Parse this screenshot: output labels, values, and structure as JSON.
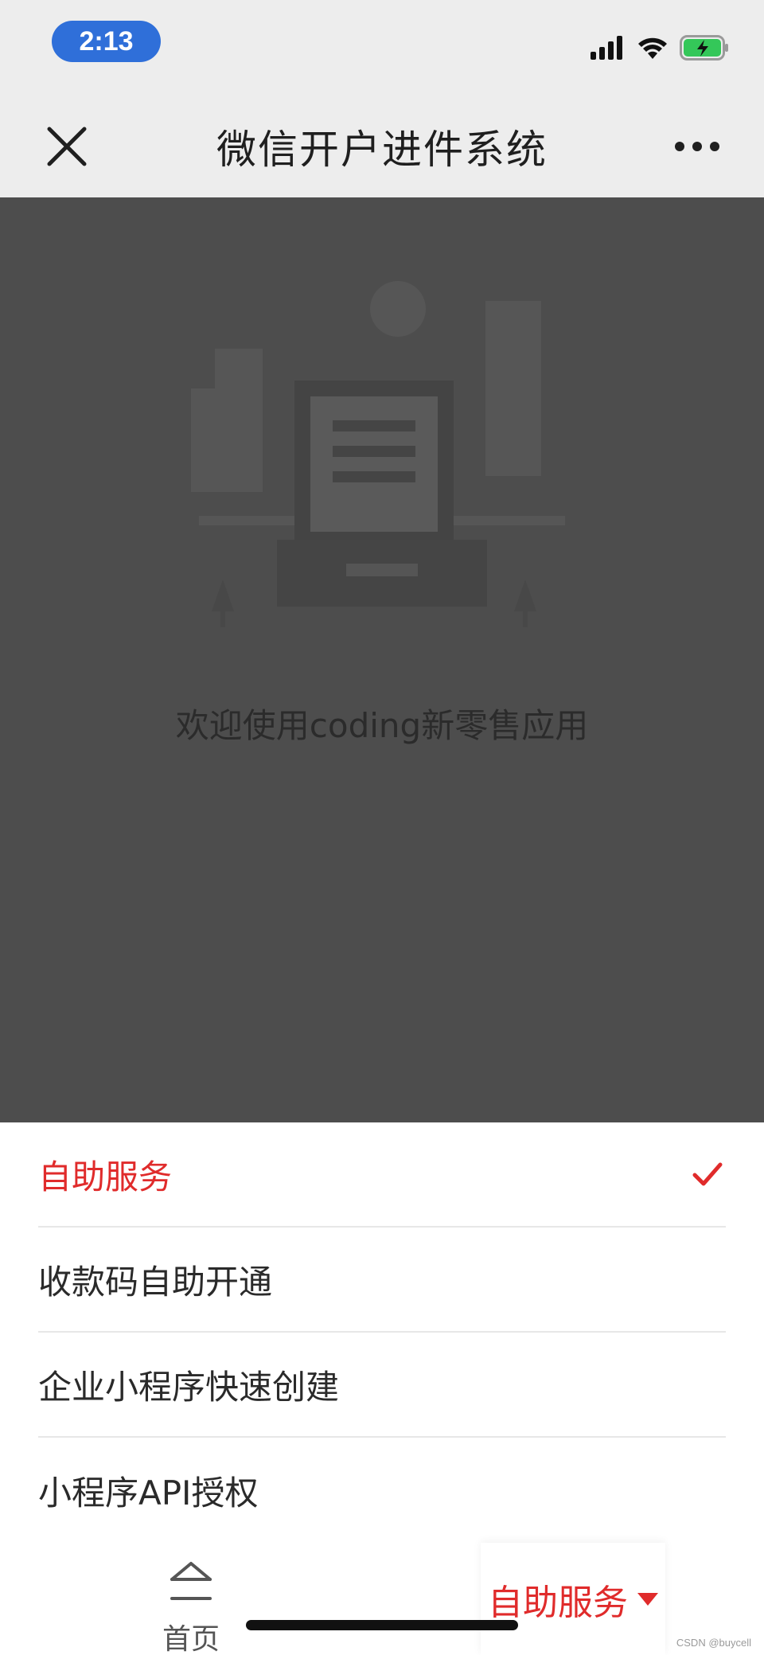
{
  "status_bar": {
    "time": "2:13",
    "icons": [
      "signal-icon",
      "wifi-icon",
      "battery-charging-icon"
    ],
    "time_pill_color": "#2f6fd9",
    "battery_color": "#34c759"
  },
  "nav": {
    "title": "微信开户进件系统",
    "close_icon": "close-icon",
    "more_icon": "more-icon"
  },
  "main": {
    "welcome": "欢迎使用coding新零售应用",
    "illustration": "building-document-illustration"
  },
  "dropdown": {
    "items": [
      {
        "label": "自助服务",
        "selected": true
      },
      {
        "label": "收款码自助开通",
        "selected": false
      },
      {
        "label": "企业小程序快速创建",
        "selected": false
      },
      {
        "label": "小程序API授权",
        "selected": false
      }
    ],
    "accent_color": "#e02b2b"
  },
  "tabbar": {
    "home_label": "首页",
    "service_label": "自助服务"
  },
  "watermark": "CSDN @buycell"
}
